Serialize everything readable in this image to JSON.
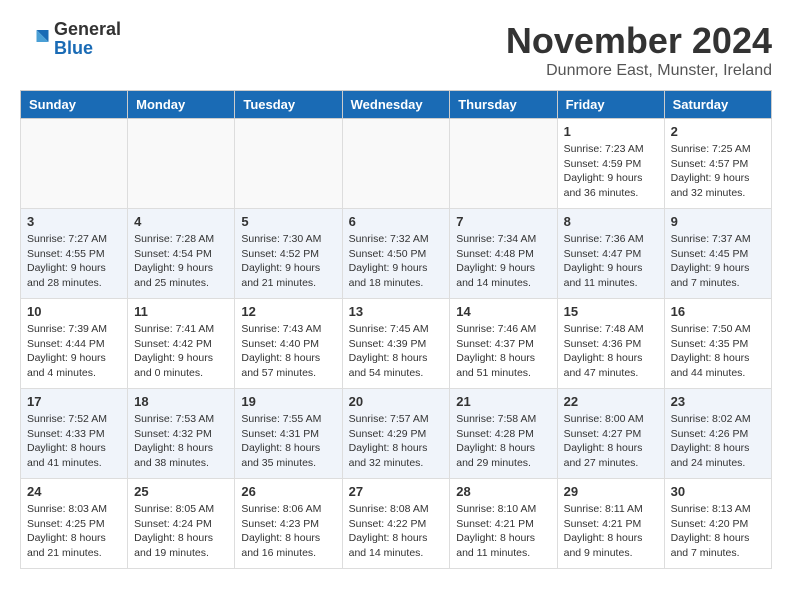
{
  "logo": {
    "general": "General",
    "blue": "Blue"
  },
  "title": "November 2024",
  "location": "Dunmore East, Munster, Ireland",
  "weekdays": [
    "Sunday",
    "Monday",
    "Tuesday",
    "Wednesday",
    "Thursday",
    "Friday",
    "Saturday"
  ],
  "weeks": [
    [
      {
        "day": "",
        "info": ""
      },
      {
        "day": "",
        "info": ""
      },
      {
        "day": "",
        "info": ""
      },
      {
        "day": "",
        "info": ""
      },
      {
        "day": "",
        "info": ""
      },
      {
        "day": "1",
        "info": "Sunrise: 7:23 AM\nSunset: 4:59 PM\nDaylight: 9 hours and 36 minutes."
      },
      {
        "day": "2",
        "info": "Sunrise: 7:25 AM\nSunset: 4:57 PM\nDaylight: 9 hours and 32 minutes."
      }
    ],
    [
      {
        "day": "3",
        "info": "Sunrise: 7:27 AM\nSunset: 4:55 PM\nDaylight: 9 hours and 28 minutes."
      },
      {
        "day": "4",
        "info": "Sunrise: 7:28 AM\nSunset: 4:54 PM\nDaylight: 9 hours and 25 minutes."
      },
      {
        "day": "5",
        "info": "Sunrise: 7:30 AM\nSunset: 4:52 PM\nDaylight: 9 hours and 21 minutes."
      },
      {
        "day": "6",
        "info": "Sunrise: 7:32 AM\nSunset: 4:50 PM\nDaylight: 9 hours and 18 minutes."
      },
      {
        "day": "7",
        "info": "Sunrise: 7:34 AM\nSunset: 4:48 PM\nDaylight: 9 hours and 14 minutes."
      },
      {
        "day": "8",
        "info": "Sunrise: 7:36 AM\nSunset: 4:47 PM\nDaylight: 9 hours and 11 minutes."
      },
      {
        "day": "9",
        "info": "Sunrise: 7:37 AM\nSunset: 4:45 PM\nDaylight: 9 hours and 7 minutes."
      }
    ],
    [
      {
        "day": "10",
        "info": "Sunrise: 7:39 AM\nSunset: 4:44 PM\nDaylight: 9 hours and 4 minutes."
      },
      {
        "day": "11",
        "info": "Sunrise: 7:41 AM\nSunset: 4:42 PM\nDaylight: 9 hours and 0 minutes."
      },
      {
        "day": "12",
        "info": "Sunrise: 7:43 AM\nSunset: 4:40 PM\nDaylight: 8 hours and 57 minutes."
      },
      {
        "day": "13",
        "info": "Sunrise: 7:45 AM\nSunset: 4:39 PM\nDaylight: 8 hours and 54 minutes."
      },
      {
        "day": "14",
        "info": "Sunrise: 7:46 AM\nSunset: 4:37 PM\nDaylight: 8 hours and 51 minutes."
      },
      {
        "day": "15",
        "info": "Sunrise: 7:48 AM\nSunset: 4:36 PM\nDaylight: 8 hours and 47 minutes."
      },
      {
        "day": "16",
        "info": "Sunrise: 7:50 AM\nSunset: 4:35 PM\nDaylight: 8 hours and 44 minutes."
      }
    ],
    [
      {
        "day": "17",
        "info": "Sunrise: 7:52 AM\nSunset: 4:33 PM\nDaylight: 8 hours and 41 minutes."
      },
      {
        "day": "18",
        "info": "Sunrise: 7:53 AM\nSunset: 4:32 PM\nDaylight: 8 hours and 38 minutes."
      },
      {
        "day": "19",
        "info": "Sunrise: 7:55 AM\nSunset: 4:31 PM\nDaylight: 8 hours and 35 minutes."
      },
      {
        "day": "20",
        "info": "Sunrise: 7:57 AM\nSunset: 4:29 PM\nDaylight: 8 hours and 32 minutes."
      },
      {
        "day": "21",
        "info": "Sunrise: 7:58 AM\nSunset: 4:28 PM\nDaylight: 8 hours and 29 minutes."
      },
      {
        "day": "22",
        "info": "Sunrise: 8:00 AM\nSunset: 4:27 PM\nDaylight: 8 hours and 27 minutes."
      },
      {
        "day": "23",
        "info": "Sunrise: 8:02 AM\nSunset: 4:26 PM\nDaylight: 8 hours and 24 minutes."
      }
    ],
    [
      {
        "day": "24",
        "info": "Sunrise: 8:03 AM\nSunset: 4:25 PM\nDaylight: 8 hours and 21 minutes."
      },
      {
        "day": "25",
        "info": "Sunrise: 8:05 AM\nSunset: 4:24 PM\nDaylight: 8 hours and 19 minutes."
      },
      {
        "day": "26",
        "info": "Sunrise: 8:06 AM\nSunset: 4:23 PM\nDaylight: 8 hours and 16 minutes."
      },
      {
        "day": "27",
        "info": "Sunrise: 8:08 AM\nSunset: 4:22 PM\nDaylight: 8 hours and 14 minutes."
      },
      {
        "day": "28",
        "info": "Sunrise: 8:10 AM\nSunset: 4:21 PM\nDaylight: 8 hours and 11 minutes."
      },
      {
        "day": "29",
        "info": "Sunrise: 8:11 AM\nSunset: 4:21 PM\nDaylight: 8 hours and 9 minutes."
      },
      {
        "day": "30",
        "info": "Sunrise: 8:13 AM\nSunset: 4:20 PM\nDaylight: 8 hours and 7 minutes."
      }
    ]
  ]
}
